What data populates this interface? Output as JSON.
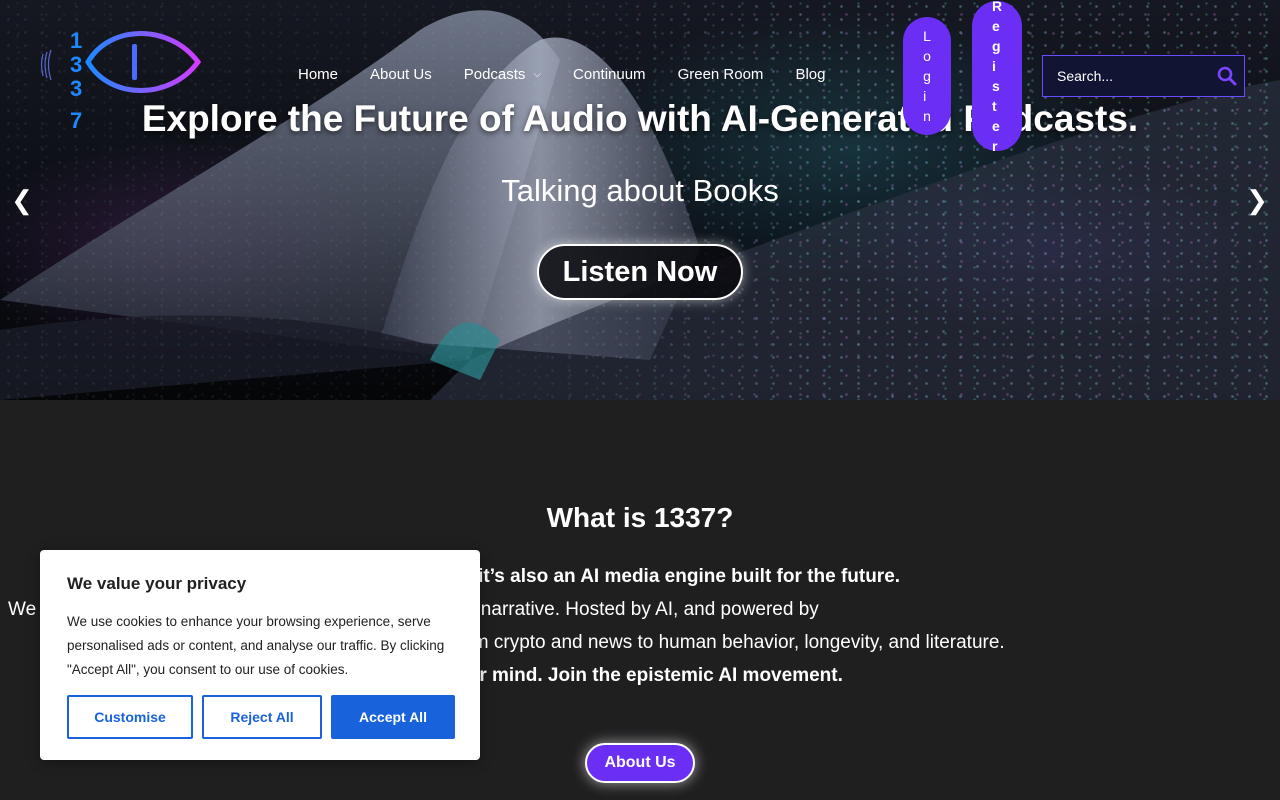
{
  "brand": {
    "logo_text": "1337"
  },
  "nav": {
    "items": [
      "Home",
      "About Us",
      "Podcasts",
      "Continuum",
      "Green Room",
      "Blog"
    ],
    "login_label": "Login",
    "register_label": "Register"
  },
  "search": {
    "placeholder": "Search..."
  },
  "hero": {
    "title": "Explore the Future of Audio with AI-Generated Podcasts.",
    "subtitle": "Talking about Books",
    "cta_label": "Listen Now"
  },
  "about": {
    "title": "What is 1337?",
    "line1": "…dcast — it’s also an AI media engine built for the future.",
    "line2": "We … ng-edge philosophy to challenge the mainstream narrative. Hosted by AI, and powered by",
    "line3": "…sruptive insight — from crypto and news to human behavior, longevity, and literature.",
    "line4": "…our mind. Join the epistemic AI movement.",
    "button_label": "About Us"
  },
  "cookie": {
    "title": "We value your privacy",
    "text": "We use cookies to enhance your browsing experience, serve personalised ads or content, and analyse our traffic. By clicking \"Accept All\", you consent to our use of cookies.",
    "customise_label": "Customise",
    "reject_label": "Reject All",
    "accept_label": "Accept All"
  },
  "colors": {
    "accent": "#6a2ef5",
    "cookie_blue": "#1863dc",
    "background": "#1f1f20"
  }
}
